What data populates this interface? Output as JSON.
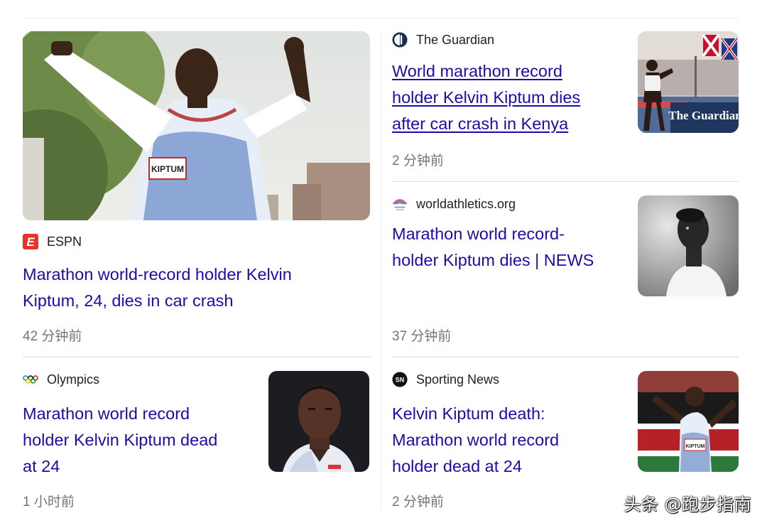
{
  "news": {
    "cards": [
      {
        "source": "ESPN",
        "headline_lines": [
          "Marathon world-record holder Kelvin",
          "Kiptum, 24, dies in car crash"
        ],
        "time": "42 分钟前",
        "image_text": "KIPTUM"
      },
      {
        "source": "The Guardian",
        "headline_lines": [
          "World marathon record",
          "holder Kelvin Kiptum dies",
          "after car crash in Kenya"
        ],
        "time": "2 分钟前",
        "image_text": "The Guardian"
      },
      {
        "source": "worldathletics.org",
        "headline_lines": [
          "Marathon world record-",
          "holder Kiptum dies | NEWS"
        ],
        "time": "37 分钟前"
      },
      {
        "source": "Olympics",
        "headline_lines": [
          "Marathon world record",
          "holder Kelvin Kiptum dead",
          "at 24"
        ],
        "time": "1 小时前"
      },
      {
        "source": "Sporting News",
        "headline_lines": [
          "Kelvin Kiptum death:",
          "Marathon world record",
          "holder dead at 24"
        ],
        "time": "2 分钟前",
        "image_text": "KIPTUM"
      }
    ],
    "logos": {
      "espn": "E",
      "guardian": "G",
      "sporting_news": "SN"
    }
  },
  "watermark": "头条 @跑步指南",
  "colors": {
    "link": "#1a0dab",
    "meta": "#70757a",
    "source": "#202124",
    "divider": "#dadce0",
    "espn_red": "#e4352b"
  }
}
